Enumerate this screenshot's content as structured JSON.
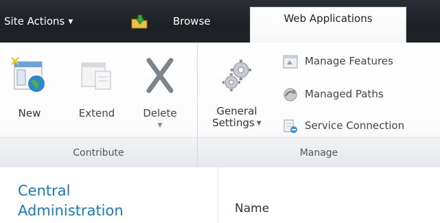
{
  "topbar": {
    "site_actions_label": "Site Actions",
    "site_actions_caret": "▼",
    "tabs": [
      {
        "label": "Browse"
      },
      {
        "label": "Web Applications",
        "selected": true
      }
    ]
  },
  "ribbon": {
    "groups": {
      "contribute": {
        "label": "Contribute",
        "buttons": [
          {
            "label": "New",
            "icon": "new-web-app-icon"
          },
          {
            "label": "Extend",
            "icon": "extend-icon"
          },
          {
            "label": "Delete",
            "icon": "delete-x-icon",
            "dropdown": "▼"
          }
        ]
      },
      "manage": {
        "label": "Manage",
        "general_settings": {
          "line1": "General",
          "line2": "Settings",
          "caret": "▼",
          "icon": "gears-icon"
        },
        "small_buttons": [
          {
            "label": "Manage Features",
            "icon": "features-icon"
          },
          {
            "label": "Managed Paths",
            "icon": "paths-icon"
          },
          {
            "label": "Service Connection",
            "icon": "service-connection-icon"
          }
        ]
      }
    }
  },
  "content": {
    "nav_link_line1": "Central",
    "nav_link_line2": "Administration",
    "column_header": "Name"
  },
  "colors": {
    "topbar": "#1f2227",
    "link": "#1b7ab5",
    "ribbon_bg": "#fbfbfc"
  }
}
